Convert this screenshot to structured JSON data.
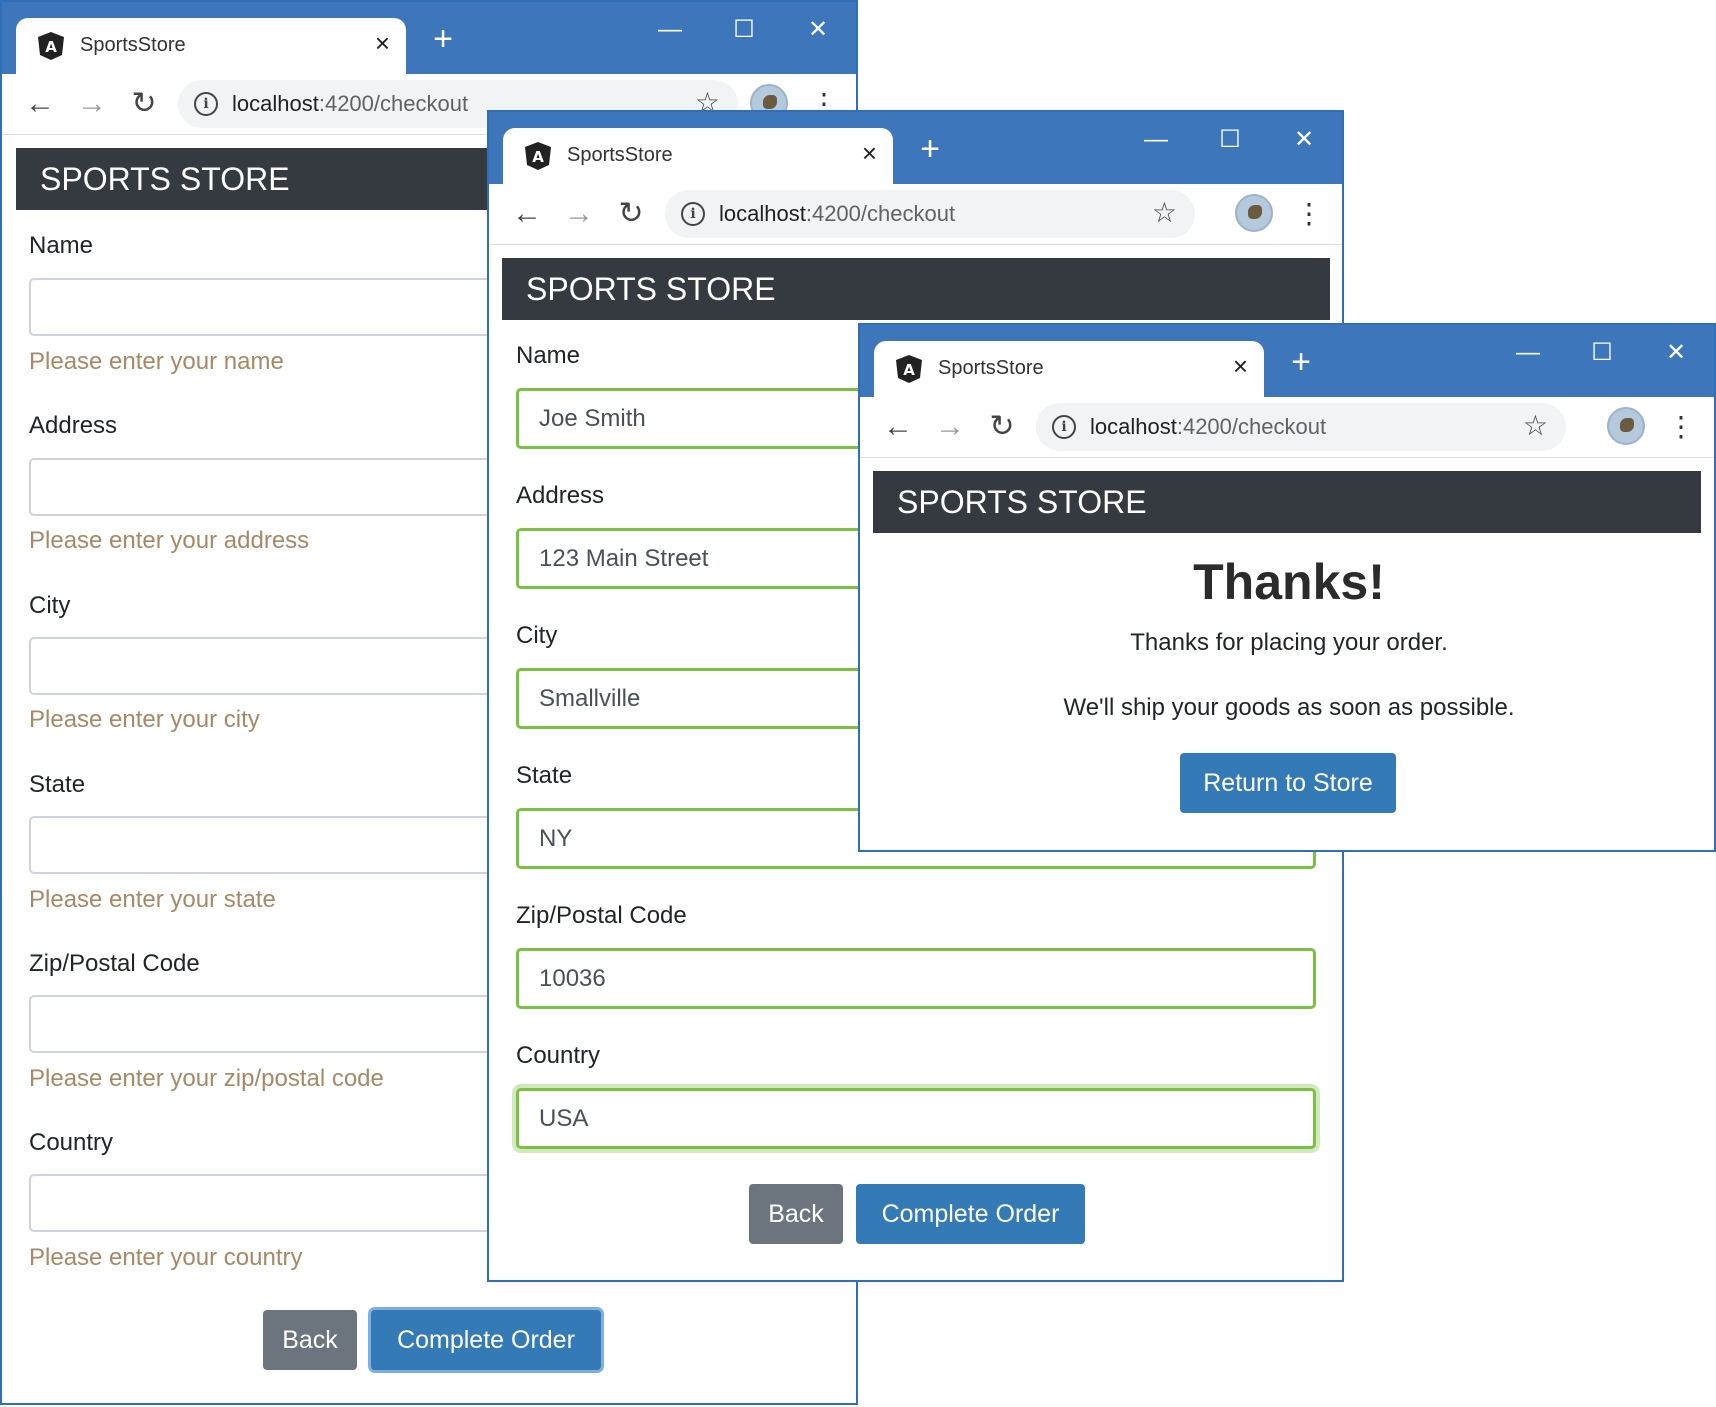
{
  "colors": {
    "titlebar": "#3d76bb",
    "banner": "#343a40",
    "primary": "#337ab7",
    "secondary": "#6c757d",
    "valid_border": "#7ac143",
    "error_text": "#a98865"
  },
  "icons": [
    "angular-icon",
    "close-icon",
    "plus-icon",
    "minimize-icon",
    "maximize-icon",
    "back-arrow-icon",
    "forward-arrow-icon",
    "reload-icon",
    "info-icon",
    "star-icon",
    "avatar",
    "kebab-menu-icon"
  ],
  "browser": {
    "tab_title": "SportsStore",
    "url_host": "localhost",
    "url_path": ":4200/checkout",
    "close_glyph": "×",
    "new_tab_glyph": "+",
    "minimize_glyph": "—",
    "maximize_glyph": "☐",
    "window_close_glyph": "✕",
    "back_glyph": "←",
    "forward_glyph": "→",
    "reload_glyph": "↻",
    "info_glyph": "i",
    "star_glyph": "☆",
    "menu_glyph": "⋮"
  },
  "store": {
    "title": "SPORTS STORE"
  },
  "form": {
    "labels": {
      "name": "Name",
      "address": "Address",
      "city": "City",
      "state": "State",
      "zip": "Zip/Postal Code",
      "country": "Country"
    },
    "errors": {
      "name": "Please enter your name",
      "address": "Please enter your address",
      "city": "Please enter your city",
      "state": "Please enter your state",
      "zip": "Please enter your zip/postal code",
      "country": "Please enter your country"
    },
    "filled_values": {
      "name": "Joe Smith",
      "address": "123 Main Street",
      "city": "Smallville",
      "state": "NY",
      "zip": "10036",
      "country": "USA"
    },
    "back_label": "Back",
    "complete_label": "Complete Order"
  },
  "thanks": {
    "title": "Thanks!",
    "line1": "Thanks for placing your order.",
    "line2": "We'll ship your goods as soon as possible.",
    "return_label": "Return to Store"
  }
}
